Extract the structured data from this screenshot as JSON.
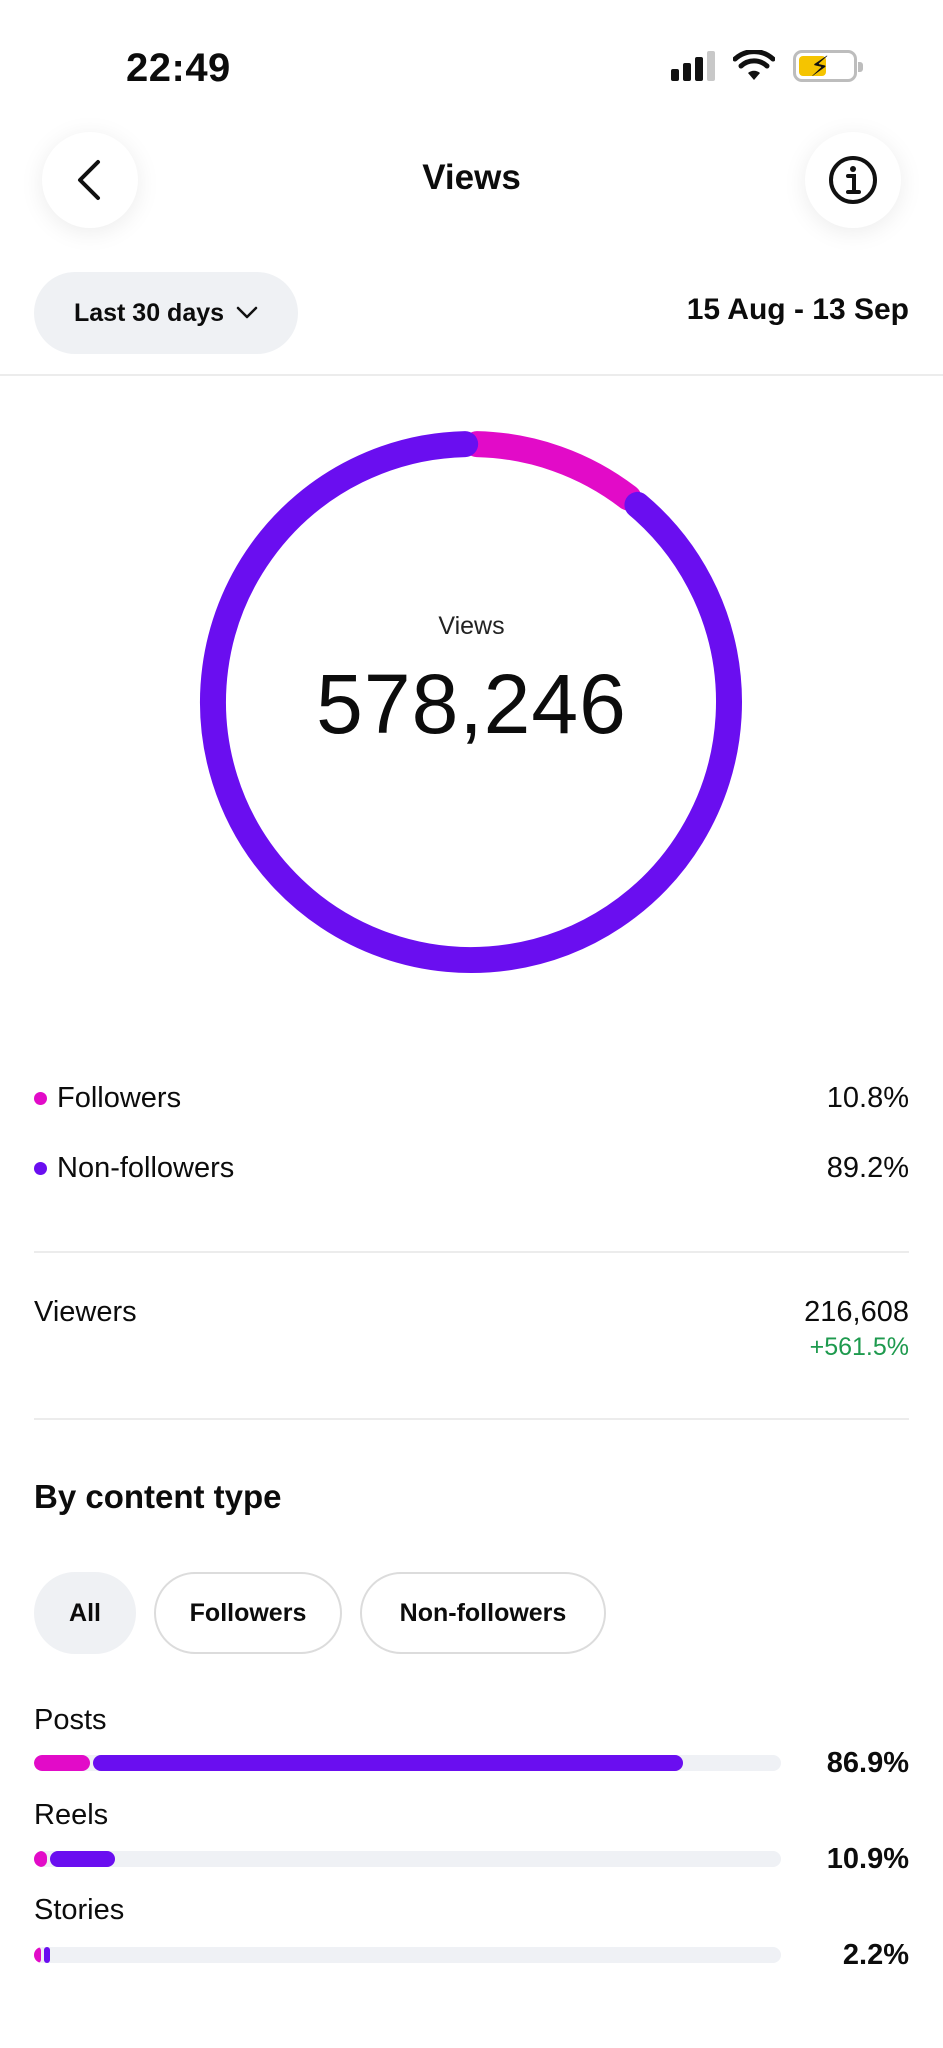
{
  "status_bar": {
    "time": "22:49"
  },
  "header": {
    "title": "Views"
  },
  "filter": {
    "range_label": "Last 30 days",
    "date_range": "15 Aug - 13 Sep"
  },
  "summary": {
    "label": "Views",
    "total": "578,246",
    "legend": [
      {
        "label": "Followers",
        "percent": "10.8%",
        "value": 10.8,
        "color": "#e20bc8"
      },
      {
        "label": "Non-followers",
        "percent": "89.2%",
        "value": 89.2,
        "color": "#6a0ef0"
      }
    ]
  },
  "viewers": {
    "label": "Viewers",
    "value": "216,608",
    "change": "+561.5%"
  },
  "content_type": {
    "title": "By content type",
    "tabs": [
      "All",
      "Followers",
      "Non-followers"
    ],
    "active_tab": "All",
    "rows": [
      {
        "label": "Posts",
        "percent": "86.9%",
        "value": 86.9,
        "followers_share": 7.5
      },
      {
        "label": "Reels",
        "percent": "10.9%",
        "value": 10.9,
        "followers_share": 1.8
      },
      {
        "label": "Stories",
        "percent": "2.2%",
        "value": 2.2,
        "followers_share": 1.0
      }
    ]
  },
  "colors": {
    "followers": "#e20bc8",
    "non_followers": "#6a0ef0",
    "positive": "#1e9a4e"
  },
  "icons": {
    "back": "chevron-left-icon",
    "info": "info-circle-icon",
    "dropdown": "chevron-down-icon"
  }
}
